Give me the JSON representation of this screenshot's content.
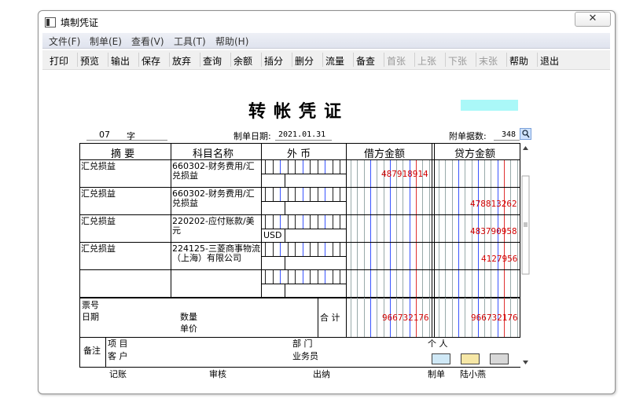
{
  "window": {
    "title": "填制凭证",
    "close_symbol": "✕"
  },
  "menu": [
    "文件(F)",
    "制单(E)",
    "查看(V)",
    "工具(T)",
    "帮助(H)"
  ],
  "toolbar": [
    {
      "label": "打印",
      "enabled": true
    },
    {
      "label": "预览",
      "enabled": true
    },
    {
      "label": "输出",
      "enabled": true
    },
    {
      "label": "保存",
      "enabled": true
    },
    {
      "label": "放弃",
      "enabled": true
    },
    {
      "label": "查询",
      "enabled": true
    },
    {
      "label": "余额",
      "enabled": true
    },
    {
      "label": "插分",
      "enabled": true
    },
    {
      "label": "删分",
      "enabled": true
    },
    {
      "label": "流量",
      "enabled": true
    },
    {
      "label": "备查",
      "enabled": true
    },
    {
      "label": "首张",
      "enabled": false
    },
    {
      "label": "上张",
      "enabled": false
    },
    {
      "label": "下张",
      "enabled": false
    },
    {
      "label": "末张",
      "enabled": false
    },
    {
      "label": "帮助",
      "enabled": true
    },
    {
      "label": "退出",
      "enabled": true
    }
  ],
  "voucher": {
    "title": "转帐凭证",
    "number": "07",
    "type_char": "字",
    "date_label": "制单日期:",
    "date": "2021.01.31",
    "attach_label": "附单据数:",
    "attach_count": "348",
    "headers": {
      "summary": "摘 要",
      "account": "科目名称",
      "currency": "外 币",
      "debit": "借方金额",
      "credit": "贷方金额"
    },
    "rows": [
      {
        "summary": "汇兑损益",
        "account": "660302-财务费用/汇兑损益",
        "currency": "",
        "debit": "487918914",
        "credit": ""
      },
      {
        "summary": "汇兑损益",
        "account": "660302-财务费用/汇兑损益",
        "currency": "",
        "debit": "",
        "credit": "478813262"
      },
      {
        "summary": "汇兑损益",
        "account": "220202-应付账款/美元",
        "currency": "USD",
        "debit": "",
        "credit": "483790958"
      },
      {
        "summary": "汇兑损益",
        "account": "224125-三菱商事物流（上海）有限公司",
        "currency": "",
        "debit": "",
        "credit": "4127956"
      },
      {
        "summary": "",
        "account": "",
        "currency": "",
        "debit": "",
        "credit": ""
      }
    ],
    "footer": {
      "ticket_no_label": "票号",
      "date_label": "日期",
      "qty_label": "数量",
      "price_label": "单价",
      "total_label": "合 计",
      "debit_total": "966732176",
      "credit_total": "966732176",
      "remark_label": "备注",
      "project_label": "项 目",
      "customer_label": "客 户",
      "dept_label": "部 门",
      "salesman_label": "业务员",
      "person_label": "个 人"
    },
    "signatures": {
      "bookkeeper_label": "记账",
      "auditor_label": "审核",
      "cashier_label": "出纳",
      "maker_label": "制单",
      "maker_name": "陆小燕"
    }
  },
  "colors": {
    "amount": "#d00000",
    "cyan_box": "#aaf8f8",
    "grid_blue": "#3a55ff",
    "grid_red": "#e03030"
  }
}
